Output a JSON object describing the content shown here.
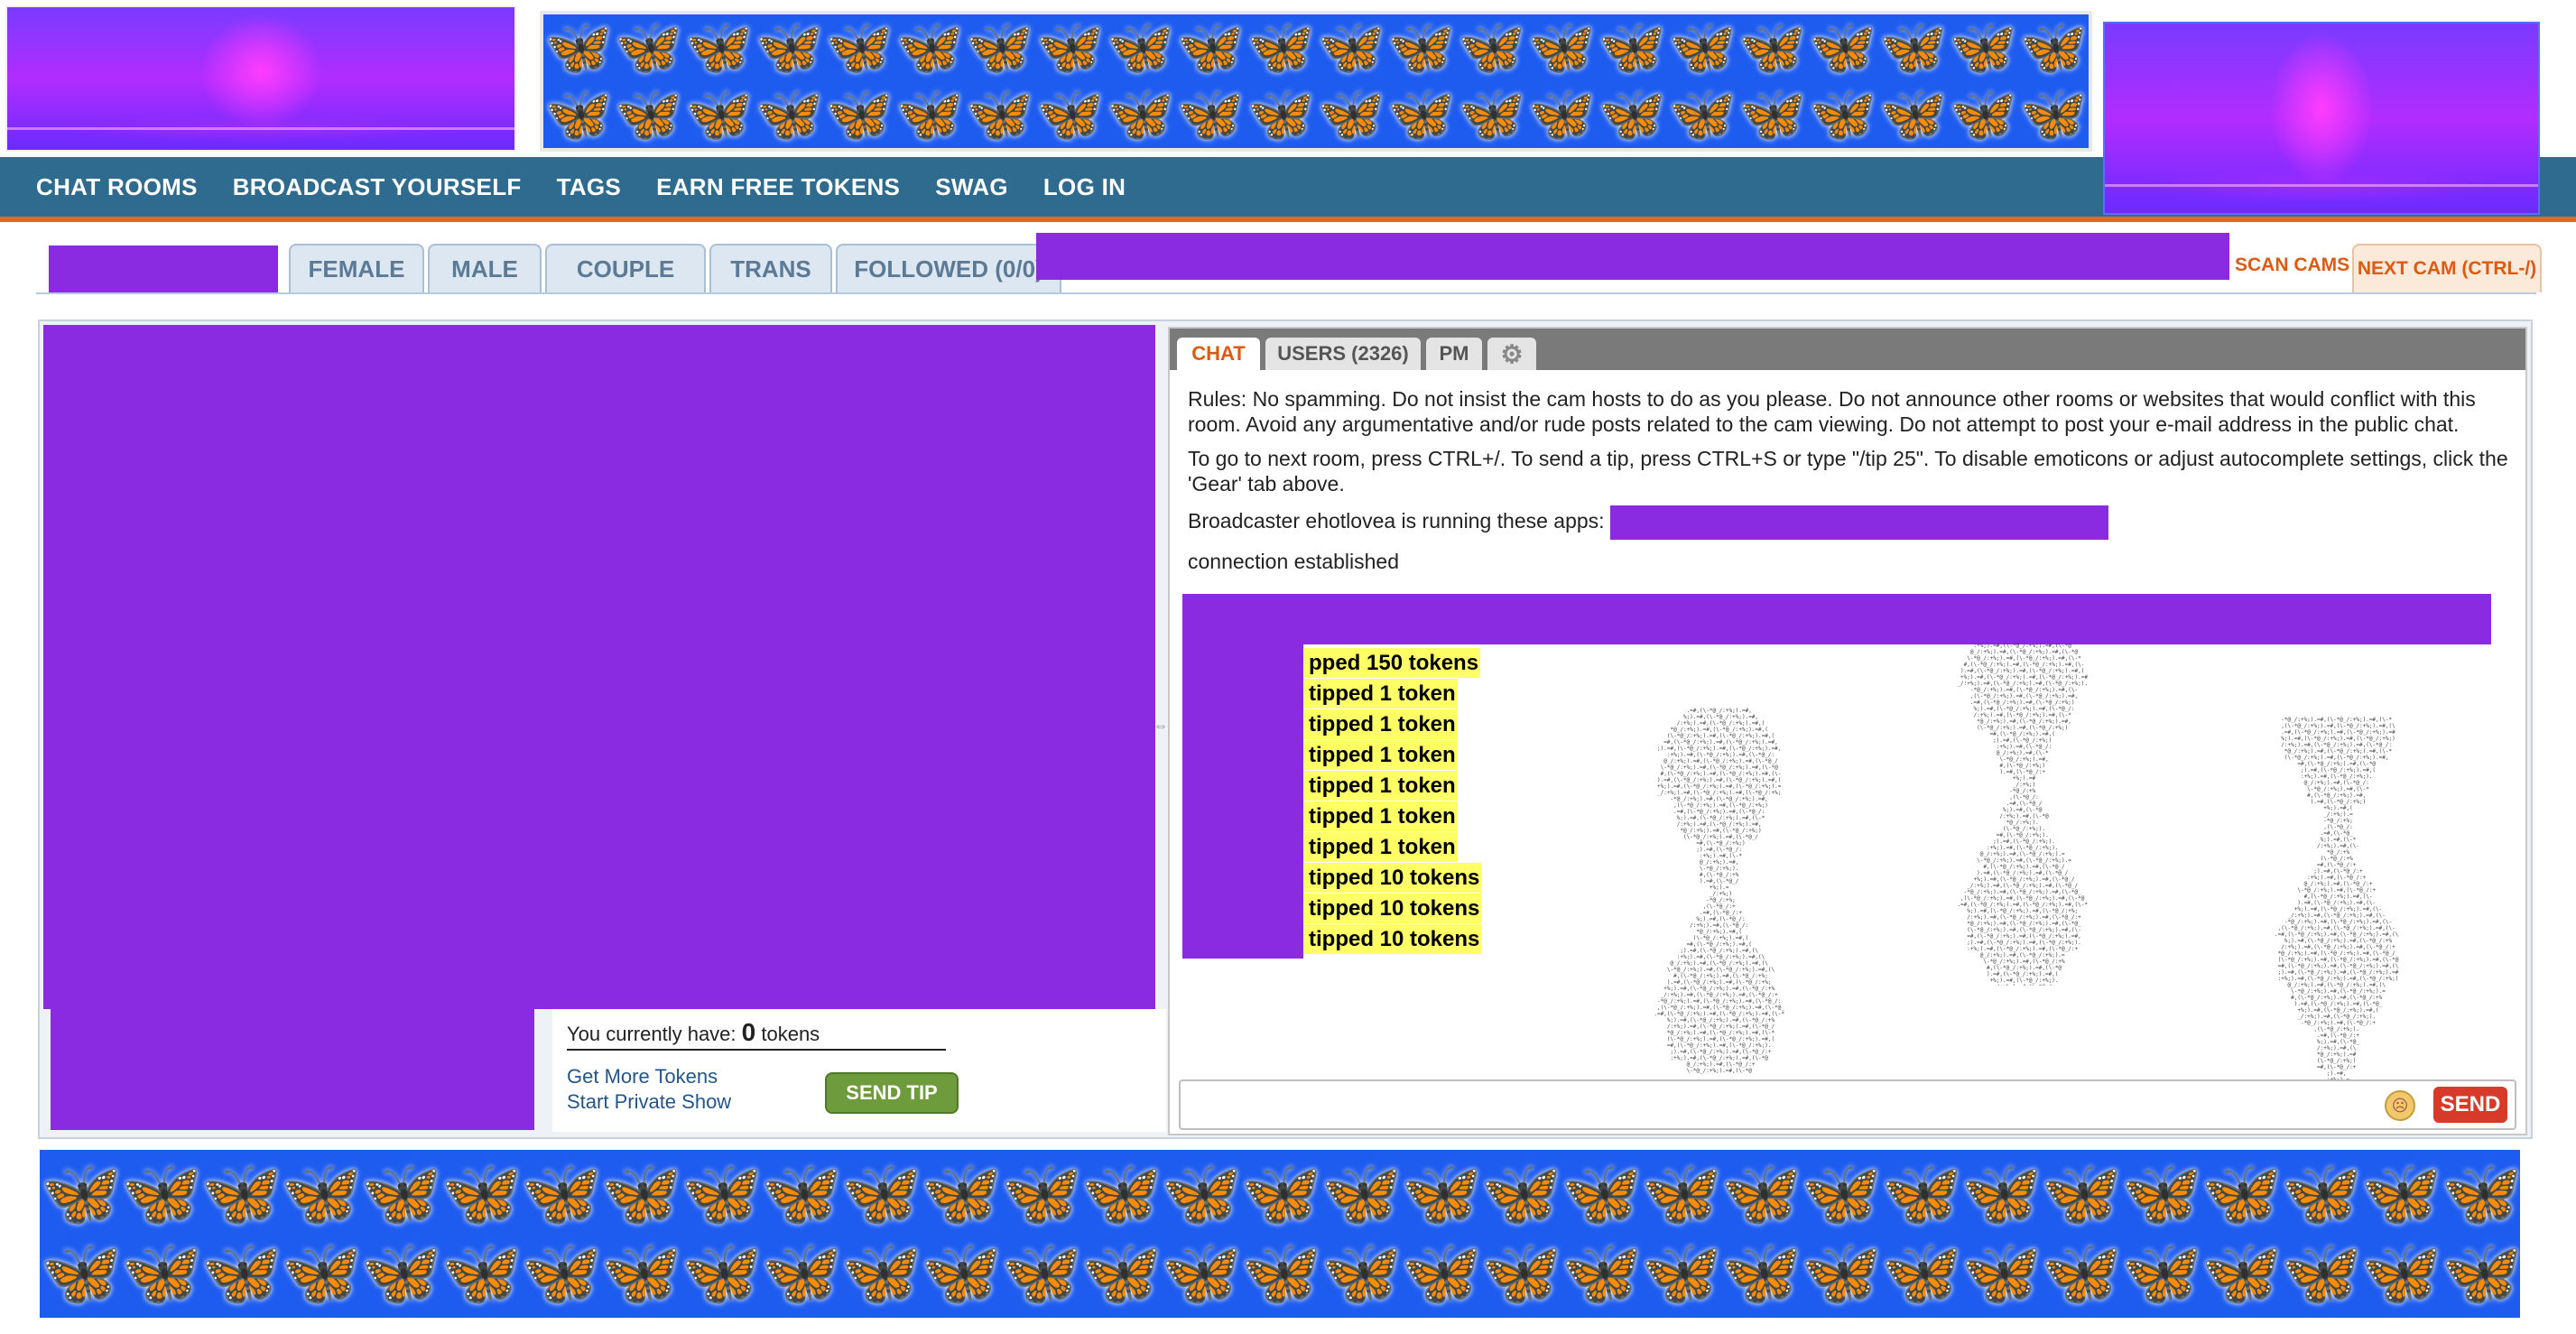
{
  "nav": {
    "items": [
      {
        "label": "CHAT ROOMS"
      },
      {
        "label": "BROADCAST YOURSELF"
      },
      {
        "label": "TAGS"
      },
      {
        "label": "EARN FREE TOKENS"
      },
      {
        "label": "SWAG"
      },
      {
        "label": "LOG IN"
      }
    ]
  },
  "category_tabs": {
    "female": "FEMALE",
    "male": "MALE",
    "couple": "COUPLE",
    "trans": "TRANS",
    "followed": "FOLLOWED (0/0)",
    "scan_cams": "SCAN CAMS",
    "next_cam": "NEXT CAM (CTRL-/)"
  },
  "tip_panel": {
    "tokens_prefix": "You currently have:",
    "tokens_count": "0",
    "tokens_suffix": "tokens",
    "get_more_tokens": "Get More Tokens",
    "start_private_show": "Start Private Show",
    "send_tip": "SEND TIP"
  },
  "chat": {
    "tabs": {
      "chat": "CHAT",
      "users": "USERS (2326)",
      "pm": "PM",
      "gear_icon": "⚙"
    },
    "rules": "Rules: No spamming. Do not insist the cam hosts to do as you please. Do not announce other rooms or websites that would conflict with this room. Avoid any argumentative and/or rude posts related to the cam viewing. Do not attempt to post your e-mail address in the public chat.",
    "instructions": "To go to next room, press CTRL+/. To send a tip, press CTRL+S or type \"/tip 25\". To disable emoticons or adjust autocomplete settings, click the 'Gear' tab above.",
    "apps_text": "Broadcaster ehotlovea is running these apps:",
    "connection": "connection established",
    "tip_messages": [
      "pped 150 tokens",
      "tipped 1 token",
      "tipped 1 token",
      "tipped 1 token",
      "tipped 1 token",
      "tipped 1 token",
      "tipped 1 token",
      "tipped 10 tokens",
      "tipped 10 tokens",
      "tipped 10 tokens"
    ],
    "send_button": "SEND"
  },
  "colors": {
    "nav_bg": "#2e6b8f",
    "nav_border": "#e06a1e",
    "redacted_block": "#8a2be2",
    "butterfly_bg": "#1e5cf0",
    "tip_highlight": "#ffff66",
    "send_button": "#d83a2a",
    "send_tip_button": "#6e9b3c"
  },
  "icons": {
    "emoticon": "emoticon-icon",
    "gear": "gear-icon",
    "butterfly": "butterfly-icon"
  }
}
